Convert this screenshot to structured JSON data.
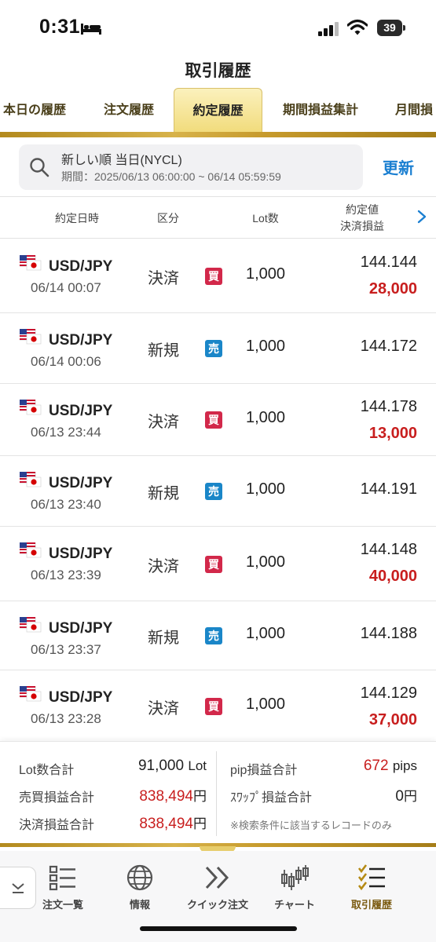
{
  "status_bar": {
    "time": "0:31",
    "battery": "39"
  },
  "header": {
    "title": "取引履歴"
  },
  "tabs": [
    {
      "label": "本日の履歴"
    },
    {
      "label": "注文履歴"
    },
    {
      "label": "約定履歴",
      "active": true
    },
    {
      "label": "期間損益集計"
    },
    {
      "label": "月間損"
    }
  ],
  "search": {
    "line1": "新しい順 当日(NYCL)",
    "line2": "期間：2025/06/13 06:00:00 ~ 06/14 05:59:59",
    "refresh_label": "更新"
  },
  "columns": {
    "datetime": "約定日時",
    "type": "区分",
    "lot": "Lot数",
    "price": "約定値",
    "pl": "決済損益"
  },
  "trades": [
    {
      "pair": "USD/JPY",
      "time": "06/14 00:07",
      "type": "決済",
      "side": "買",
      "side_kind": "buy",
      "lot": "1,000",
      "price": "144.144",
      "pl": "28,000"
    },
    {
      "pair": "USD/JPY",
      "time": "06/14 00:06",
      "type": "新規",
      "side": "売",
      "side_kind": "sell",
      "lot": "1,000",
      "price": "144.172",
      "pl": ""
    },
    {
      "pair": "USD/JPY",
      "time": "06/13 23:44",
      "type": "決済",
      "side": "買",
      "side_kind": "buy",
      "lot": "1,000",
      "price": "144.178",
      "pl": "13,000"
    },
    {
      "pair": "USD/JPY",
      "time": "06/13 23:40",
      "type": "新規",
      "side": "売",
      "side_kind": "sell",
      "lot": "1,000",
      "price": "144.191",
      "pl": ""
    },
    {
      "pair": "USD/JPY",
      "time": "06/13 23:39",
      "type": "決済",
      "side": "買",
      "side_kind": "buy",
      "lot": "1,000",
      "price": "144.148",
      "pl": "40,000"
    },
    {
      "pair": "USD/JPY",
      "time": "06/13 23:37",
      "type": "新規",
      "side": "売",
      "side_kind": "sell",
      "lot": "1,000",
      "price": "144.188",
      "pl": ""
    },
    {
      "pair": "USD/JPY",
      "time": "06/13 23:28",
      "type": "決済",
      "side": "買",
      "side_kind": "buy",
      "lot": "1,000",
      "price": "144.129",
      "pl": "37,000"
    }
  ],
  "summary": {
    "lot_total_label": "Lot数合計",
    "lot_total_value": "91,000",
    "lot_total_unit": "Lot",
    "trade_pl_label": "売買損益合計",
    "trade_pl_value": "838,494",
    "trade_pl_unit": "円",
    "settle_pl_label": "決済損益合計",
    "settle_pl_value": "838,494",
    "settle_pl_unit": "円",
    "pip_label": "pip損益合計",
    "pip_value": "672",
    "pip_unit": "pips",
    "swap_label": "ｽﾜｯﾌﾟ損益合計",
    "swap_value": "0",
    "swap_unit": "円",
    "note": "※検索条件に該当するレコードのみ"
  },
  "bottom_nav": [
    {
      "label": "注文一覧",
      "icon": "list-icon"
    },
    {
      "label": "情報",
      "icon": "globe-icon"
    },
    {
      "label": "クイック注文",
      "icon": "double-chevron-icon"
    },
    {
      "label": "チャート",
      "icon": "candlestick-icon"
    },
    {
      "label": "取引履歴",
      "icon": "checklist-icon",
      "active": true
    }
  ],
  "colors": {
    "accent_gold": "#c9a23a",
    "buy": "#d2284a",
    "sell": "#1a86c8",
    "profit": "#c81e1e",
    "link": "#1a7fd1"
  }
}
